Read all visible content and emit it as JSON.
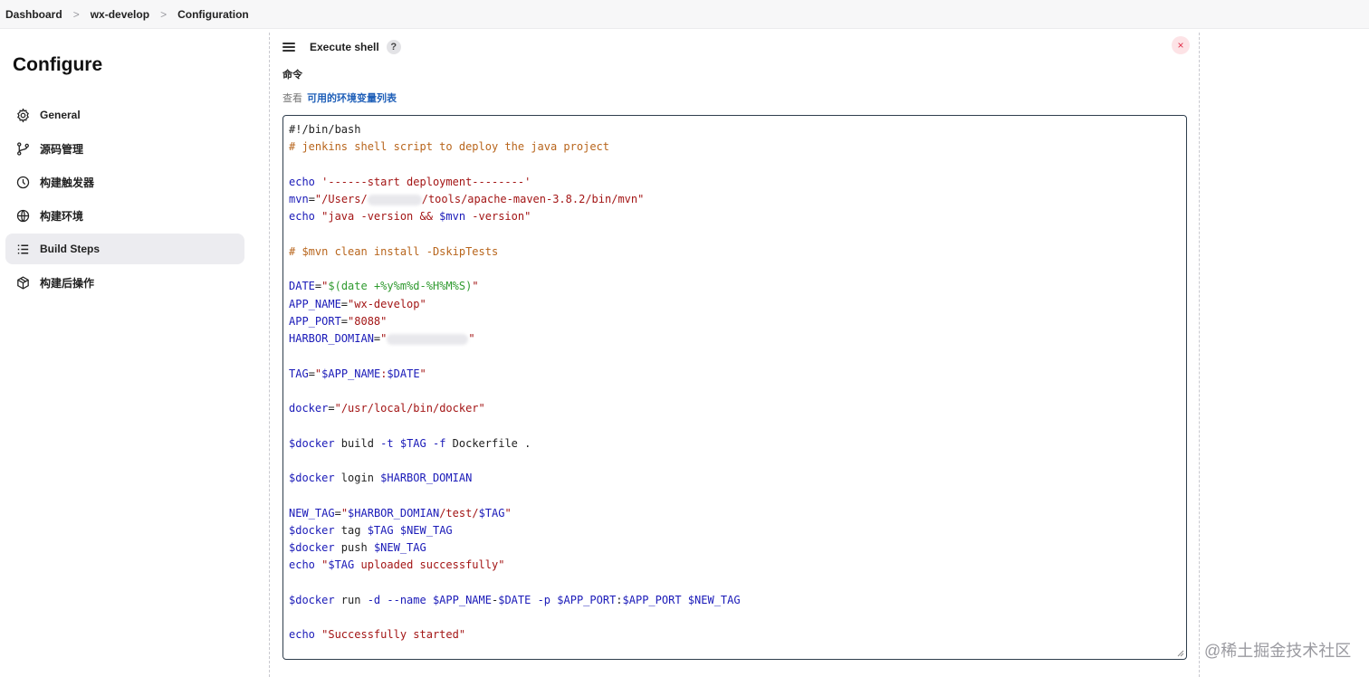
{
  "breadcrumb": {
    "items": [
      "Dashboard",
      "wx-develop",
      "Configuration"
    ],
    "separator": ">"
  },
  "sidebar": {
    "title": "Configure",
    "items": [
      {
        "label": "General",
        "icon": "gear-icon",
        "active": false
      },
      {
        "label": "源码管理",
        "icon": "branch-icon",
        "active": false
      },
      {
        "label": "构建触发器",
        "icon": "timer-icon",
        "active": false
      },
      {
        "label": "构建环境",
        "icon": "globe-icon",
        "active": false
      },
      {
        "label": "Build Steps",
        "icon": "list-icon",
        "active": true
      },
      {
        "label": "构建后操作",
        "icon": "package-icon",
        "active": false
      }
    ]
  },
  "step": {
    "title": "Execute shell",
    "help": "?",
    "close": "×",
    "command_label": "命令",
    "env_prefix": "查看",
    "env_link": "可用的环境变量列表"
  },
  "editor": {
    "lines": [
      [
        {
          "c": "plain",
          "t": "#!/bin/bash"
        }
      ],
      [
        {
          "c": "comment",
          "t": "# jenkins shell script to deploy the java project"
        }
      ],
      [],
      [
        {
          "c": "kw",
          "t": "echo "
        },
        {
          "c": "str",
          "t": "'------start deployment--------'"
        }
      ],
      [
        {
          "c": "var",
          "t": "mvn"
        },
        {
          "c": "plain",
          "t": "="
        },
        {
          "c": "str",
          "t": "\"/Users/"
        },
        {
          "c": "blur",
          "w": 60
        },
        {
          "c": "str",
          "t": "/tools/apache-maven-3.8.2/bin/mvn\""
        }
      ],
      [
        {
          "c": "kw",
          "t": "echo "
        },
        {
          "c": "str",
          "t": "\"java -version && "
        },
        {
          "c": "var",
          "t": "$mvn"
        },
        {
          "c": "str",
          "t": " -version\""
        }
      ],
      [],
      [
        {
          "c": "comment",
          "t": "# $mvn clean install -DskipTests"
        }
      ],
      [],
      [
        {
          "c": "var",
          "t": "DATE"
        },
        {
          "c": "plain",
          "t": "="
        },
        {
          "c": "str",
          "t": "\""
        },
        {
          "c": "green",
          "t": "$(date +%y%m%d-%H%M%S)"
        },
        {
          "c": "str",
          "t": "\""
        }
      ],
      [
        {
          "c": "var",
          "t": "APP_NAME"
        },
        {
          "c": "plain",
          "t": "="
        },
        {
          "c": "str",
          "t": "\"wx-develop\""
        }
      ],
      [
        {
          "c": "var",
          "t": "APP_PORT"
        },
        {
          "c": "plain",
          "t": "="
        },
        {
          "c": "str",
          "t": "\"8088\""
        }
      ],
      [
        {
          "c": "var",
          "t": "HARBOR_DOMIAN"
        },
        {
          "c": "plain",
          "t": "="
        },
        {
          "c": "str",
          "t": "\""
        },
        {
          "c": "blur",
          "w": 90
        },
        {
          "c": "str",
          "t": "\""
        }
      ],
      [],
      [
        {
          "c": "var",
          "t": "TAG"
        },
        {
          "c": "plain",
          "t": "="
        },
        {
          "c": "str",
          "t": "\""
        },
        {
          "c": "var",
          "t": "$APP_NAME"
        },
        {
          "c": "str",
          "t": ":"
        },
        {
          "c": "var",
          "t": "$DATE"
        },
        {
          "c": "str",
          "t": "\""
        }
      ],
      [],
      [
        {
          "c": "var",
          "t": "docker"
        },
        {
          "c": "plain",
          "t": "="
        },
        {
          "c": "str",
          "t": "\"/usr/local/bin/docker\""
        }
      ],
      [],
      [
        {
          "c": "var",
          "t": "$docker"
        },
        {
          "c": "plain",
          "t": " build "
        },
        {
          "c": "kw",
          "t": "-t "
        },
        {
          "c": "var",
          "t": "$TAG"
        },
        {
          "c": "plain",
          "t": " "
        },
        {
          "c": "kw",
          "t": "-f"
        },
        {
          "c": "plain",
          "t": " Dockerfile ."
        }
      ],
      [],
      [
        {
          "c": "var",
          "t": "$docker"
        },
        {
          "c": "plain",
          "t": " login "
        },
        {
          "c": "var",
          "t": "$HARBOR_DOMIAN"
        }
      ],
      [],
      [
        {
          "c": "var",
          "t": "NEW_TAG"
        },
        {
          "c": "plain",
          "t": "="
        },
        {
          "c": "str",
          "t": "\""
        },
        {
          "c": "var",
          "t": "$HARBOR_DOMIAN"
        },
        {
          "c": "str",
          "t": "/test/"
        },
        {
          "c": "var",
          "t": "$TAG"
        },
        {
          "c": "str",
          "t": "\""
        }
      ],
      [
        {
          "c": "var",
          "t": "$docker"
        },
        {
          "c": "plain",
          "t": " tag "
        },
        {
          "c": "var",
          "t": "$TAG"
        },
        {
          "c": "plain",
          "t": " "
        },
        {
          "c": "var",
          "t": "$NEW_TAG"
        }
      ],
      [
        {
          "c": "var",
          "t": "$docker"
        },
        {
          "c": "plain",
          "t": " push "
        },
        {
          "c": "var",
          "t": "$NEW_TAG"
        }
      ],
      [
        {
          "c": "kw",
          "t": "echo "
        },
        {
          "c": "str",
          "t": "\""
        },
        {
          "c": "var",
          "t": "$TAG"
        },
        {
          "c": "str",
          "t": " uploaded successfully\""
        }
      ],
      [],
      [
        {
          "c": "var",
          "t": "$docker"
        },
        {
          "c": "plain",
          "t": " run "
        },
        {
          "c": "kw",
          "t": "-d --name "
        },
        {
          "c": "var",
          "t": "$APP_NAME"
        },
        {
          "c": "plain",
          "t": "-"
        },
        {
          "c": "var",
          "t": "$DATE"
        },
        {
          "c": "plain",
          "t": " "
        },
        {
          "c": "kw",
          "t": "-p "
        },
        {
          "c": "var",
          "t": "$APP_PORT"
        },
        {
          "c": "plain",
          "t": ":"
        },
        {
          "c": "var",
          "t": "$APP_PORT"
        },
        {
          "c": "plain",
          "t": " "
        },
        {
          "c": "var",
          "t": "$NEW_TAG"
        }
      ],
      [],
      [
        {
          "c": "kw",
          "t": "echo "
        },
        {
          "c": "str",
          "t": "\"Successfully started\""
        }
      ]
    ]
  },
  "watermark": "@稀土掘金技术社区",
  "colors": {
    "comment": "#b8651c",
    "keyword": "#1a1ab8",
    "string": "#a31515",
    "green": "#2f9a2f",
    "active_nav": "#ececf0",
    "close_bg": "#fde3e6",
    "close_fg": "#e0304a",
    "link": "#1f5fb8"
  }
}
